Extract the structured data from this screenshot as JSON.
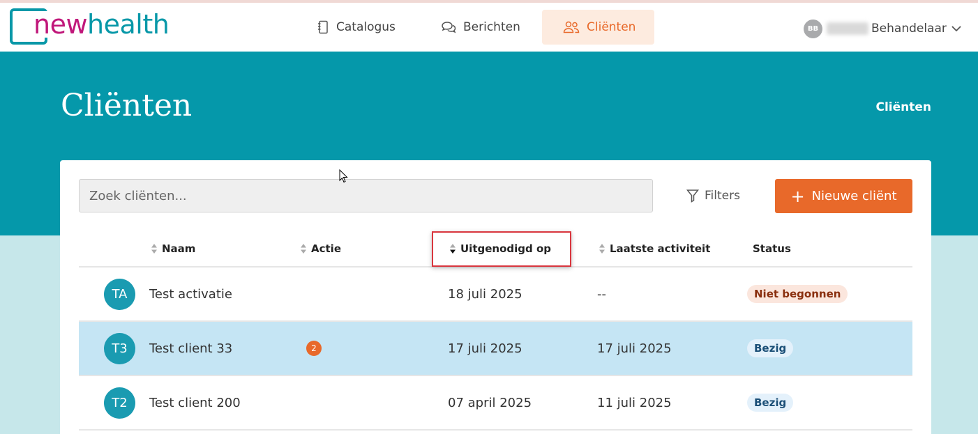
{
  "brand": {
    "logo_text_a": "new",
    "logo_text_b": "health"
  },
  "nav": [
    {
      "label": "Catalogus",
      "icon": "notebook-icon"
    },
    {
      "label": "Berichten",
      "icon": "chat-bubbles-icon"
    },
    {
      "label": "Cliënten",
      "icon": "users-icon",
      "active": true
    }
  ],
  "user": {
    "initials": "BB",
    "role": "Behandelaar"
  },
  "page": {
    "title": "Cliënten",
    "breadcrumb": "Cliënten"
  },
  "toolbar": {
    "search_placeholder": "Zoek cliënten...",
    "filters_label": "Filters",
    "new_client_label": "Nieuwe cliënt"
  },
  "table": {
    "columns": [
      "Naam",
      "Actie",
      "Uitgenodigd op",
      "Laatste activiteit",
      "Status"
    ],
    "sorted_column": "Uitgenodigd op",
    "rows": [
      {
        "initials": "TA",
        "name": "Test activatie",
        "action": "",
        "invited": "18 juli 2025",
        "last_activity": "--",
        "status": "Niet begonnen"
      },
      {
        "initials": "T3",
        "name": "Test client 33",
        "action": "2",
        "invited": "17 juli 2025",
        "last_activity": "17 juli 2025",
        "status": "Bezig"
      },
      {
        "initials": "T2",
        "name": "Test client 200",
        "action": "",
        "invited": "07 april 2025",
        "last_activity": "11 juli 2025",
        "status": "Bezig"
      }
    ]
  },
  "colors": {
    "teal": "#0598aa",
    "accent_orange": "#e8692a",
    "selected_row": "#c5e5f4",
    "highlight_red": "#d9363e"
  }
}
